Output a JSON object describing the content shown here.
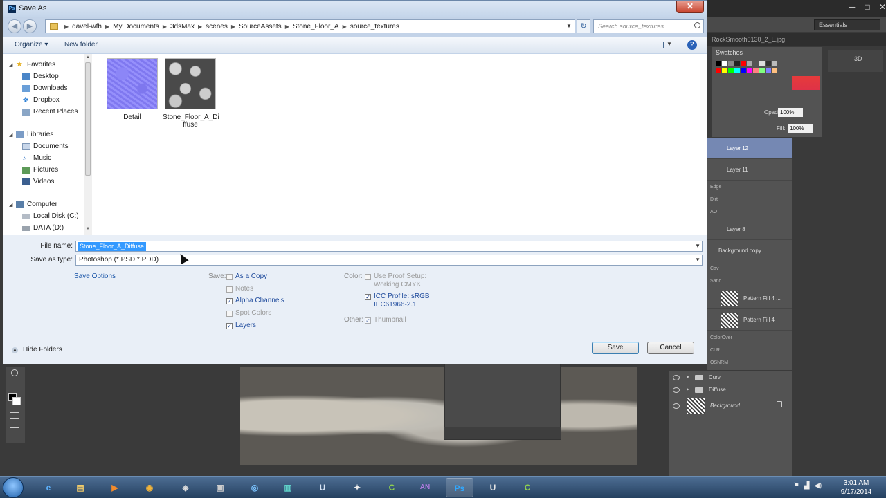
{
  "dialog": {
    "title": "Save As",
    "close_symbol": "✕",
    "breadcrumb": [
      "davel-wfh",
      "My Documents",
      "3dsMax",
      "scenes",
      "SourceAssets",
      "Stone_Floor_A",
      "source_textures"
    ],
    "search_placeholder": "Search source_textures",
    "toolbar": {
      "organize": "Organize ▾",
      "new_folder": "New folder",
      "help": "?"
    },
    "nav": {
      "favorites": "Favorites",
      "favorites_items": [
        "Desktop",
        "Downloads",
        "Dropbox",
        "Recent Places"
      ],
      "libraries": "Libraries",
      "libraries_items": [
        "Documents",
        "Music",
        "Pictures",
        "Videos"
      ],
      "computer": "Computer",
      "computer_items": [
        "Local Disk (C:)",
        "DATA (D:)"
      ]
    },
    "files": [
      {
        "name": "Detail"
      },
      {
        "name": "Stone_Floor_A_Diffuse",
        "name_line1": "Stone_Floor_A_Di",
        "name_line2": "ffuse"
      }
    ],
    "file_name_label": "File name:",
    "file_name_value": "Stone_Floor_A_Diffuse",
    "save_as_type_label": "Save as type:",
    "save_as_type_value": "Photoshop (*.PSD;*.PDD)",
    "save_options_link": "Save Options",
    "save_label": "Save:",
    "save_checkboxes": [
      {
        "label": "As a Copy",
        "checked": false,
        "enabled": true
      },
      {
        "label": "Notes",
        "checked": false,
        "enabled": false
      },
      {
        "label": "Alpha Channels",
        "checked": true,
        "enabled": true
      },
      {
        "label": "Spot Colors",
        "checked": false,
        "enabled": false
      },
      {
        "label": "Layers",
        "checked": true,
        "enabled": true
      }
    ],
    "color_label": "Color:",
    "use_proof_setup": "Use Proof Setup:",
    "working_cmyk": "Working CMYK",
    "icc_profile_line1": "ICC Profile:  sRGB",
    "icc_profile_line2": "IEC61966-2.1",
    "other_label": "Other:",
    "thumbnail": "Thumbnail",
    "hide_folders": "Hide Folders",
    "save_button": "Save",
    "cancel_button": "Cancel"
  },
  "photoshop": {
    "workspace": "Essentials",
    "doc_tab": "RockSmooth0130_2_L.jpg",
    "swatches_title": "Swatches",
    "threed_label": "3D",
    "opacity_label": "Opacity:",
    "opacity_value": "100%",
    "fill_label": "Fill:",
    "fill_value": "100%",
    "layers": [
      {
        "name": "Layer 12",
        "selected": true
      },
      {
        "name": "Layer 11"
      },
      {
        "name": "Edge",
        "small": true
      },
      {
        "name": "Dirt",
        "small": true
      },
      {
        "name": "AO",
        "small": true
      },
      {
        "name": "Layer 8"
      },
      {
        "name": "Background copy"
      },
      {
        "name": "Cav",
        "small": true
      },
      {
        "name": "Sand",
        "small": true
      },
      {
        "name": "Pattern Fill 4 ...",
        "thumb": true
      },
      {
        "name": "Pattern Fill 4",
        "thumb": true
      },
      {
        "name": "ColorOver",
        "small": true
      },
      {
        "name": "CLR",
        "small": true
      },
      {
        "name": "OSNRM",
        "small": true
      }
    ],
    "layer_groups": [
      "Curv",
      "Diffuse"
    ],
    "background_layer": "Background"
  },
  "taskbar": {
    "apps": [
      "e",
      "▤",
      "▶",
      "◉",
      "◈",
      "▣",
      "◎",
      "▥",
      "U",
      "✦",
      "C",
      "AN",
      "Ps",
      "U",
      "C"
    ],
    "active_app": "Ps",
    "time": "3:01 AM",
    "date": "9/17/2014"
  },
  "colors": {
    "selection_blue": "#3399ff",
    "layer_selected": "#7588b3",
    "link_blue": "#1a55a8"
  }
}
